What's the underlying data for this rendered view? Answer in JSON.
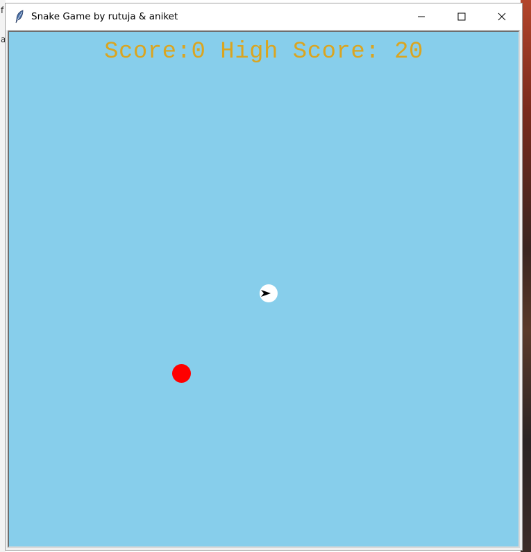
{
  "window": {
    "title": "Snake Game by rutuja & aniket"
  },
  "score": {
    "text": "Score:0 High Score: 20",
    "current": 0,
    "high": 20,
    "color": "#daa520"
  },
  "canvas": {
    "background": "#87ceeb"
  },
  "snake": {
    "head_color": "#ffffff",
    "length": 1,
    "direction": "right"
  },
  "food": {
    "color": "#ff0000"
  },
  "desktop_fragments": {
    "top": "f",
    "middle": "a"
  },
  "icons": {
    "app": "feather-icon",
    "minimize": "minimize-icon",
    "maximize": "maximize-icon",
    "close": "close-icon"
  }
}
